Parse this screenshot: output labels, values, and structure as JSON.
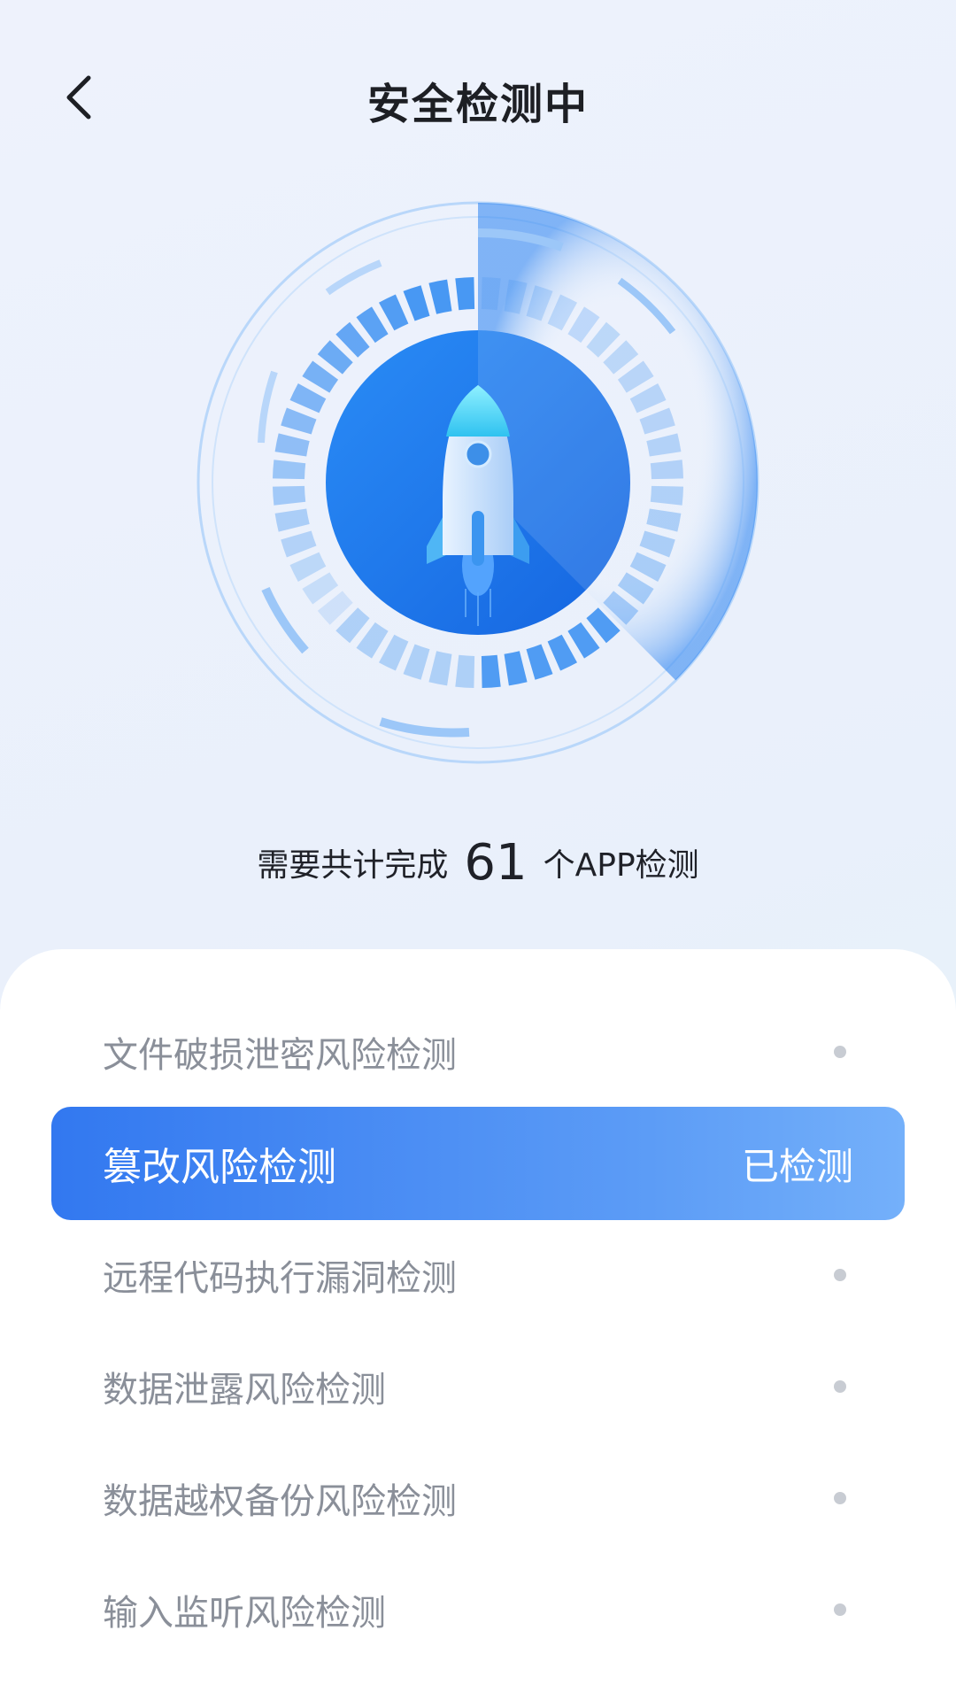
{
  "header": {
    "title": "安全检测中",
    "back_icon": "chevron-left-icon"
  },
  "scanner": {
    "center_icon": "rocket-icon",
    "accent_color": "#1e7bf0",
    "light_color": "#a9d0fb"
  },
  "summary": {
    "prefix": "需要共计完成",
    "count": "61",
    "suffix": "个APP检测"
  },
  "checks": [
    {
      "label": "文件破损泄密风险检测",
      "status": "",
      "active": false
    },
    {
      "label": "篡改风险检测",
      "status": "已检测",
      "active": true
    },
    {
      "label": "远程代码执行漏洞检测",
      "status": "",
      "active": false
    },
    {
      "label": "数据泄露风险检测",
      "status": "",
      "active": false
    },
    {
      "label": "数据越权备份风险检测",
      "status": "",
      "active": false
    },
    {
      "label": "输入监听风险检测",
      "status": "",
      "active": false
    }
  ]
}
